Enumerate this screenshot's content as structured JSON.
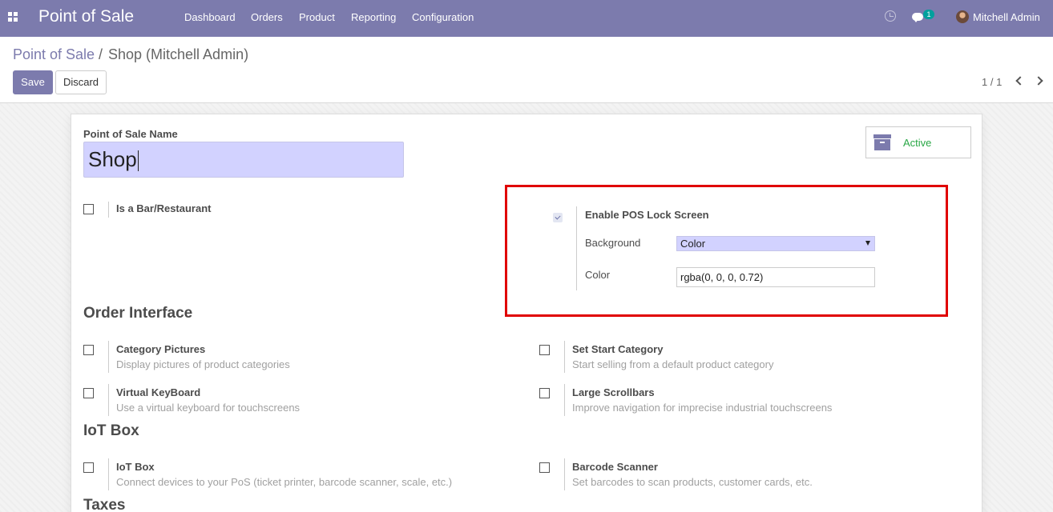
{
  "navbar": {
    "app_title": "Point of Sale",
    "menu": [
      "Dashboard",
      "Orders",
      "Product",
      "Reporting",
      "Configuration"
    ],
    "chat_badge": "1",
    "user_name": "Mitchell Admin",
    "icons": [
      "apps-grid-icon",
      "clock-icon",
      "chat-icon",
      "avatar"
    ]
  },
  "breadcrumb": {
    "parent": "Point of Sale",
    "separator": "/",
    "current": "Shop (Mitchell Admin)"
  },
  "toolbar": {
    "save_label": "Save",
    "discard_label": "Discard",
    "pager": "1 / 1"
  },
  "form": {
    "name_label": "Point of Sale Name",
    "name_value": "Shop",
    "active_label": "Active",
    "bar_restaurant": {
      "title": "Is a Bar/Restaurant",
      "checked": false
    },
    "lock_screen": {
      "title": "Enable POS Lock Screen",
      "checked": true,
      "background_label": "Background",
      "background_value": "Color",
      "color_label": "Color",
      "color_value": "rgba(0, 0, 0, 0.72)"
    },
    "order_interface": {
      "title": "Order Interface",
      "settings": [
        {
          "title": "Category Pictures",
          "desc": "Display pictures of product categories",
          "checked": false
        },
        {
          "title": "Set Start Category",
          "desc": "Start selling from a default product category",
          "checked": false
        },
        {
          "title": "Virtual KeyBoard",
          "desc": "Use a virtual keyboard for touchscreens",
          "checked": false
        },
        {
          "title": "Large Scrollbars",
          "desc": "Improve navigation for imprecise industrial touchscreens",
          "checked": false
        }
      ]
    },
    "iot_box": {
      "title": "IoT Box",
      "settings": [
        {
          "title": "IoT Box",
          "desc": "Connect devices to your PoS (ticket printer, barcode scanner, scale, etc.)",
          "checked": false
        },
        {
          "title": "Barcode Scanner",
          "desc": "Set barcodes to scan products, customer cards, etc.",
          "checked": false
        }
      ]
    },
    "taxes": {
      "title": "Taxes"
    }
  },
  "colors": {
    "brand": "#7c7bad",
    "active_green": "#28a745",
    "highlight_red": "#e00000",
    "input_bg": "#d2d2ff"
  }
}
